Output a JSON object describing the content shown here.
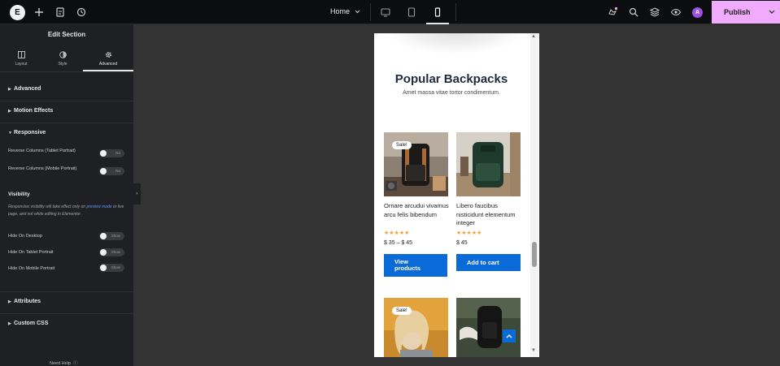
{
  "topbar": {
    "page_name": "Home",
    "publish_label": "Publish",
    "avatar_letter": "A"
  },
  "panel": {
    "title": "Edit Section",
    "tabs": [
      {
        "label": "Layout",
        "icon": "layout-icon"
      },
      {
        "label": "Style",
        "icon": "style-icon"
      },
      {
        "label": "Advanced",
        "icon": "gear-icon"
      }
    ],
    "active_tab": "Advanced",
    "sections": {
      "advanced": "Advanced",
      "motion": "Motion Effects",
      "responsive": "Responsive",
      "attributes": "Attributes",
      "custom_css": "Custom CSS"
    },
    "responsive": {
      "reverse_tablet": {
        "label": "Reverse Columns (Tablet Portrait)",
        "state": "No"
      },
      "reverse_mobile": {
        "label": "Reverse Columns (Mobile Portrait)",
        "state": "No"
      }
    },
    "visibility": {
      "title": "Visibility",
      "note_before": "Responsive visibility will take effect only on ",
      "note_link": "preview mode",
      "note_after": " or live page, and not while editing in Elementor.",
      "hide_desktop": {
        "label": "Hide On Desktop",
        "state": "Show"
      },
      "hide_tablet": {
        "label": "Hide On Tablet Portrait",
        "state": "Show"
      },
      "hide_mobile": {
        "label": "Hide On Mobile Portrait",
        "state": "Show"
      }
    },
    "help": "Need Help"
  },
  "preview": {
    "heading": "Popular Backpacks",
    "subheading": "Amet massa vitae tortor condimentum.",
    "sale_badge": "Sale!",
    "products": [
      {
        "name": "Ornare arcudui vivamus arcu felis bibendum",
        "price": "$ 35 – $ 45",
        "rating": 5,
        "button": "View products",
        "sale": true
      },
      {
        "name": "Libero faucibus nisticidunt elementum integer",
        "price": "$ 45",
        "rating": 5,
        "button": "Add to cart",
        "sale": false
      }
    ],
    "products_row2": [
      {
        "sale": true
      },
      {
        "sale": false
      }
    ]
  },
  "colors": {
    "accent_blue": "#0a6ad7",
    "publish_bg": "#f0abfc",
    "star": "#f0a23a",
    "panel_bg": "#1f2023",
    "canvas_bg": "#333333"
  }
}
